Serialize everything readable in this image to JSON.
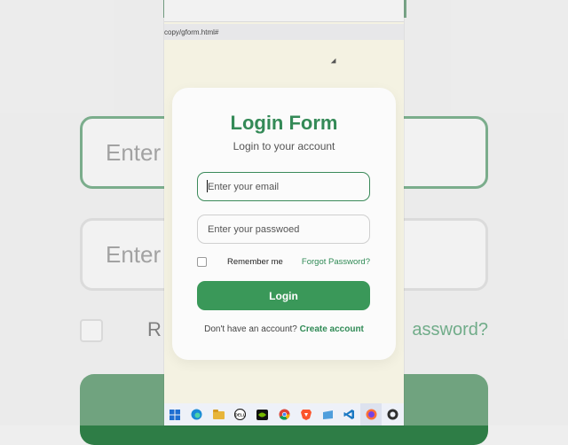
{
  "background": {
    "email_text": "Enter",
    "password_text": "Enter",
    "remember_text": "R",
    "forgot_text": "assword?"
  },
  "browser": {
    "url": "copy/gform.html#"
  },
  "form": {
    "title": "Login Form",
    "subtitle": "Login to your account",
    "email_placeholder": "Enter your email",
    "password_placeholder": "Enter your passwoed",
    "remember_label": "Remember me",
    "forgot_label": "Forgot Password?",
    "login_label": "Login",
    "signup_prompt": "Don't have an account?",
    "signup_link": "Create account"
  },
  "taskbar": {
    "icons": [
      {
        "name": "windows-start-icon",
        "color": "#1f6fd1"
      },
      {
        "name": "edge-icon",
        "color": "#1b8bd6"
      },
      {
        "name": "file-explorer-icon",
        "color": "#e7b53a"
      },
      {
        "name": "dell-icon",
        "color": "#222222"
      },
      {
        "name": "nvidia-icon",
        "color": "#5c9d1a"
      },
      {
        "name": "chrome-icon",
        "color": "#db4437"
      },
      {
        "name": "brave-icon",
        "color": "#fb542b"
      },
      {
        "name": "app-icon",
        "color": "#4f9edc"
      },
      {
        "name": "vscode-icon",
        "color": "#1a78c2"
      },
      {
        "name": "firefox-icon",
        "color": "#ff7139"
      },
      {
        "name": "obs-icon",
        "color": "#303030"
      }
    ]
  },
  "colors": {
    "brand_green": "#348a57",
    "button_green": "#3a9859",
    "page_background": "#f4f2e2"
  }
}
